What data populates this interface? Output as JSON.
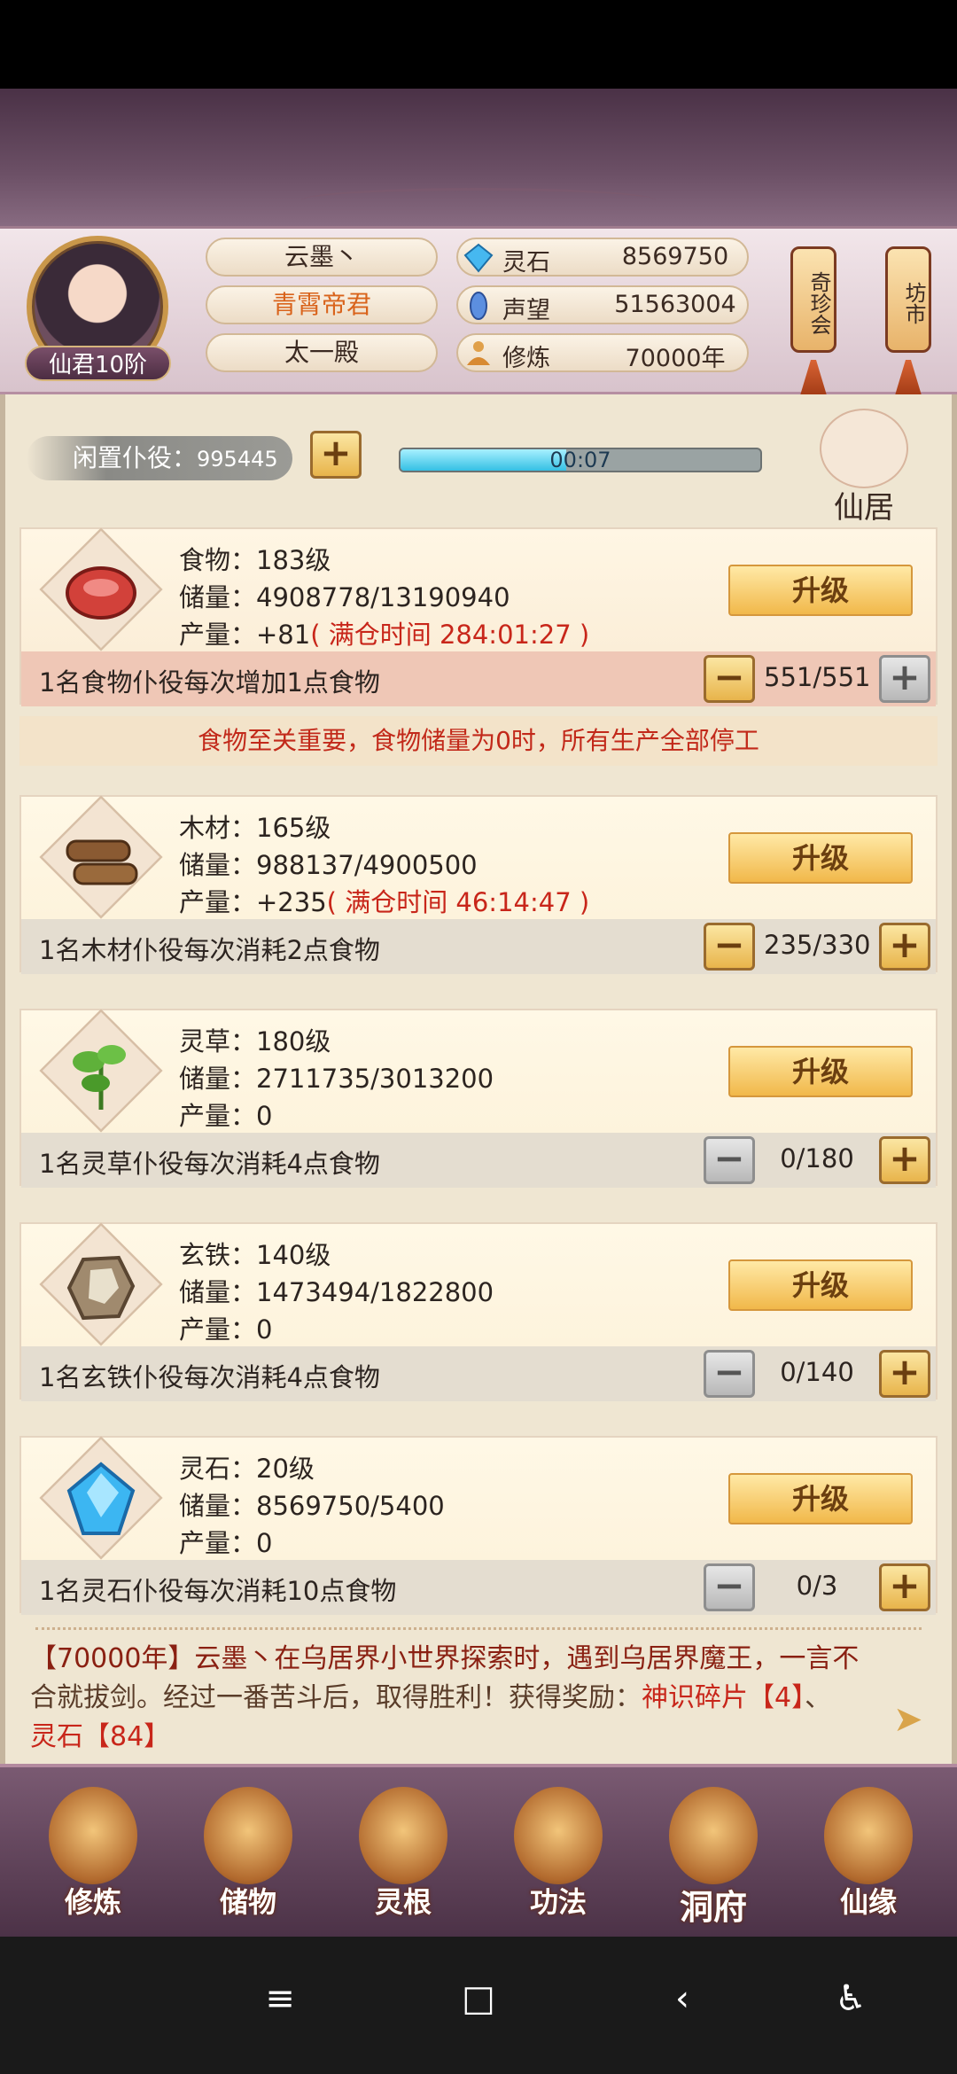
{
  "header": {
    "rank": "仙君10阶",
    "name": "云墨丶",
    "title": "青霄帝君",
    "hall": "太一殿",
    "resources": [
      {
        "label": "灵石",
        "value": "8569750",
        "icon": "gem-icon"
      },
      {
        "label": "声望",
        "value": "51563004",
        "icon": "reputation-icon"
      },
      {
        "label": "修炼",
        "value": "70000年",
        "icon": "meditation-icon"
      }
    ],
    "lantern_left": "奇珍会",
    "lantern_right": "坊市"
  },
  "idle": {
    "label": "闲置仆役：",
    "count": "995445",
    "timer": "00:07",
    "timer_progress": 0.46,
    "xianju": "仙居"
  },
  "cards": [
    {
      "name": "食物：183级",
      "storage": "储量：4908778/13190940",
      "output_prefix": "产量：+81",
      "output_extra": "( 满仓时间 284:01:27 )",
      "upgrade": "升级",
      "desc": "1名食物仆役每次增加1点食物",
      "count": "551/551",
      "icon": "meat-icon"
    },
    {
      "name": "木材：165级",
      "storage": "储量：988137/4900500",
      "output_prefix": "产量：+235",
      "output_extra": "( 满仓时间 46:14:47 )",
      "upgrade": "升级",
      "desc": "1名木材仆役每次消耗2点食物",
      "count": "235/330",
      "icon": "wood-icon"
    },
    {
      "name": "灵草：180级",
      "storage": "储量：2711735/3013200",
      "output_prefix": "产量：0",
      "output_extra": "",
      "upgrade": "升级",
      "desc": "1名灵草仆役每次消耗4点食物",
      "count": "0/180",
      "icon": "herb-icon"
    },
    {
      "name": "玄铁：140级",
      "storage": "储量：1473494/1822800",
      "output_prefix": "产量：0",
      "output_extra": "",
      "upgrade": "升级",
      "desc": "1名玄铁仆役每次消耗4点食物",
      "count": "0/140",
      "icon": "ore-icon"
    },
    {
      "name": "灵石：20级",
      "storage": "储量：8569750/5400",
      "output_prefix": "产量：0",
      "output_extra": "",
      "upgrade": "升级",
      "desc": "1名灵石仆役每次消耗10点食物",
      "count": "0/3",
      "icon": "crystal-icon"
    }
  ],
  "notice": "食物至关重要，食物储量为0时，所有生产全部停工",
  "log": {
    "line1": "【70000年】云墨丶在乌居界小世界探索时，遇到乌居界魔王，一言不",
    "line2": "合就拔剑。经过一番苦斗后，取得胜利！获得奖励：",
    "reward1": "神识碎片【4】",
    "sep": "、",
    "reward2": "灵石【84】"
  },
  "nav": [
    {
      "label": "修炼",
      "icon": "cultivate-icon"
    },
    {
      "label": "储物",
      "icon": "bag-icon"
    },
    {
      "label": "灵根",
      "icon": "spirit-root-icon"
    },
    {
      "label": "功法",
      "icon": "book-icon"
    },
    {
      "label": "洞府",
      "icon": "cave-icon"
    },
    {
      "label": "仙缘",
      "icon": "gourd-icon"
    }
  ],
  "system": [
    "≡",
    "□",
    "‹",
    "♿"
  ],
  "colors": {
    "accent_red": "#c8261a",
    "gold": "#f1b84a",
    "panel": "#efe6d2"
  }
}
